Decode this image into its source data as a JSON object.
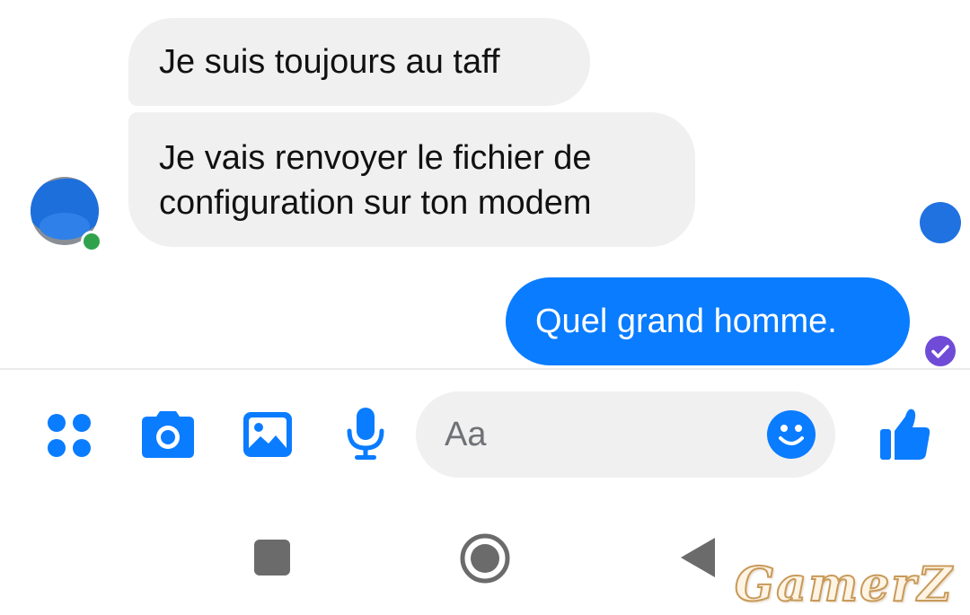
{
  "conversation": {
    "messages": [
      {
        "direction": "incoming",
        "lines": [
          "Je suis toujours au taff"
        ]
      },
      {
        "direction": "incoming",
        "lines": [
          "Je vais renvoyer le fichier de",
          "configuration sur ton modem"
        ]
      },
      {
        "direction": "outgoing",
        "lines": [
          "Quel grand homme."
        ]
      }
    ],
    "contact_status": "online",
    "last_message_status": "sent-check"
  },
  "composer": {
    "placeholder": "Aa",
    "value": ""
  },
  "toolbar": {
    "icons": [
      "apps-grid-icon",
      "camera-icon",
      "gallery-icon",
      "microphone-icon",
      "emoji-icon",
      "thumbs-up-icon"
    ]
  },
  "navigation_bar": {
    "icons": [
      "recents-square-icon",
      "home-circle-icon",
      "back-triangle-icon"
    ]
  },
  "watermark": {
    "text": "GamerZ"
  },
  "colors": {
    "accent": "#0a7cff",
    "incoming_bubble": "#f0f0f0",
    "outgoing_bubble": "#0a7cff",
    "online": "#31a24c",
    "sent_check": "#6f4bd8",
    "nav_icons": "#6b6b6b"
  }
}
